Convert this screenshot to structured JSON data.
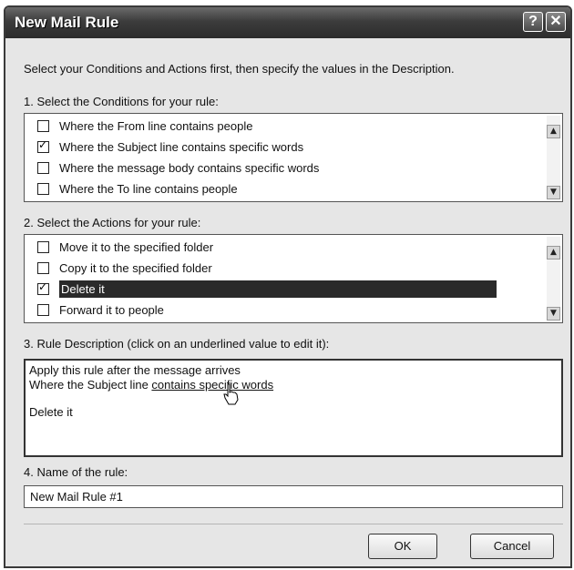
{
  "window": {
    "title": "New Mail Rule",
    "help_button": "?",
    "close_button": "✕"
  },
  "intro_text": "Select your Conditions and Actions first, then specify the values in the Description.",
  "conditions": {
    "label": "1. Select the Conditions for your rule:",
    "items": [
      {
        "label": "Where the From line contains people",
        "checked": false
      },
      {
        "label": "Where the Subject line contains specific words",
        "checked": true
      },
      {
        "label": "Where the message body contains specific words",
        "checked": false
      },
      {
        "label": "Where the To line contains people",
        "checked": false
      }
    ]
  },
  "actions": {
    "label": "2. Select the Actions for your rule:",
    "items": [
      {
        "label": "Move it to the specified folder",
        "checked": false,
        "selected": false
      },
      {
        "label": "Copy it to the specified folder",
        "checked": false,
        "selected": false
      },
      {
        "label": "Delete it",
        "checked": true,
        "selected": true
      },
      {
        "label": "Forward it to people",
        "checked": false,
        "selected": false
      }
    ]
  },
  "description": {
    "label": "3. Rule Description (click on an underlined value to edit it):",
    "line1": "Apply this rule after the message arrives",
    "line2_prefix": "Where the Subject line ",
    "line2_link": "contains specific words",
    "line3": "Delete it"
  },
  "rule_name": {
    "label": "4. Name of the rule:",
    "value": "New Mail Rule #1"
  },
  "buttons": {
    "ok": "OK",
    "cancel": "Cancel"
  },
  "icons": {
    "scroll_up": "up-arrow-icon",
    "scroll_down": "down-arrow-icon",
    "hand_cursor": "hand-pointer-icon"
  }
}
